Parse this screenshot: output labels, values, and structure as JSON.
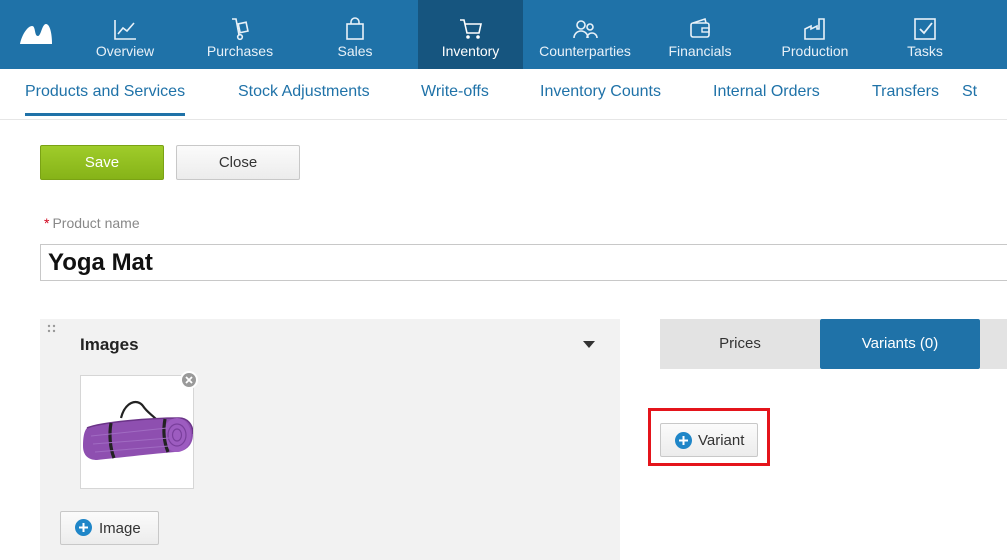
{
  "nav": {
    "items": [
      {
        "label": "Overview",
        "icon": "chart-line-icon"
      },
      {
        "label": "Purchases",
        "icon": "hand-truck-icon"
      },
      {
        "label": "Sales",
        "icon": "shopping-bag-icon"
      },
      {
        "label": "Inventory",
        "icon": "cart-icon",
        "active": true
      },
      {
        "label": "Counterparties",
        "icon": "people-icon"
      },
      {
        "label": "Financials",
        "icon": "wallet-icon"
      },
      {
        "label": "Production",
        "icon": "factory-icon"
      },
      {
        "label": "Tasks",
        "icon": "checkbox-icon"
      }
    ]
  },
  "subnav": {
    "items": [
      {
        "label": "Products and Services",
        "active": true
      },
      {
        "label": "Stock Adjustments"
      },
      {
        "label": "Write-offs"
      },
      {
        "label": "Inventory Counts"
      },
      {
        "label": "Internal Orders"
      },
      {
        "label": "Transfers"
      },
      {
        "label": "St"
      }
    ]
  },
  "toolbar": {
    "save_label": "Save",
    "close_label": "Close"
  },
  "form": {
    "name_label": "Product name",
    "required_mark": "*",
    "name_value": "Yoga Mat"
  },
  "images_panel": {
    "title": "Images",
    "add_label": "Image"
  },
  "tabs": {
    "prices_label": "Prices",
    "variants_label": "Variants (0)"
  },
  "variants": {
    "add_label": "Variant"
  },
  "colors": {
    "brand": "#1f72a8",
    "active_nav": "#16557f",
    "save_green": "#8fbf1e",
    "highlight": "#e4141b",
    "plus_blue": "#1f86c8"
  }
}
